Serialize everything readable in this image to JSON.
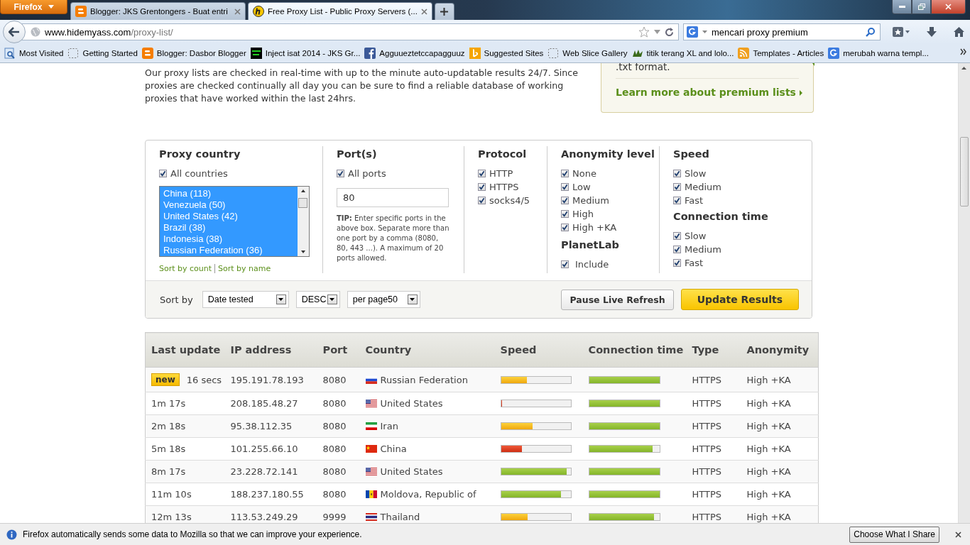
{
  "browser": {
    "menu_button": "Firefox",
    "tabs": [
      {
        "title": "Blogger: JKS Grentongers - Buat entri",
        "selected": false
      },
      {
        "title": "Free Proxy List - Public Proxy Servers (...",
        "selected": true
      }
    ],
    "url": {
      "host": "www.hidemyass.com",
      "path": "/proxy-list/"
    },
    "search": {
      "value": "mencari proxy premium"
    },
    "bookmarks": [
      {
        "label": "Most Visited"
      },
      {
        "label": "Getting Started"
      },
      {
        "label": "Blogger: Dasbor Blogger"
      },
      {
        "label": "Inject isat 2014 - JKS Gr..."
      },
      {
        "label": "Agguueztetccapagguuz"
      },
      {
        "label": "Suggested Sites"
      },
      {
        "label": "Web Slice Gallery"
      },
      {
        "label": "titik terang XL and lolo..."
      },
      {
        "label": "Templates - Articles"
      },
      {
        "label": "merubah warna templ..."
      }
    ]
  },
  "intro": {
    "text": "Our proxy lists are checked in real-time with up to the minute auto-updatable results 24/7. Since proxies are checked continually all day you can be sure to find a reliable database of working proxies that have worked within the last 24hrs."
  },
  "premium_box": {
    "text": ".txt format.",
    "link": "Learn more about premium lists"
  },
  "filters": {
    "country": {
      "title": "Proxy country",
      "all": {
        "label": "All countries",
        "checked": true
      },
      "options": [
        {
          "label": "China (118)",
          "selected": true
        },
        {
          "label": "Venezuela (50)",
          "selected": true
        },
        {
          "label": "United States (42)",
          "selected": true
        },
        {
          "label": "Brazil (38)",
          "selected": true
        },
        {
          "label": "Indonesia (38)",
          "selected": true
        },
        {
          "label": "Russian Federation (36)",
          "selected": true
        }
      ],
      "sort_links": [
        "Sort by count",
        "Sort by name"
      ]
    },
    "ports": {
      "title": "Port(s)",
      "all": {
        "label": "All ports",
        "checked": true
      },
      "value": "80",
      "tip": "**TIP:** Enter specific ports in the above box. Separate more than one port by a comma (8080, 80, 443 ...). A maximum of 20 ports allowed."
    },
    "protocol": {
      "title": "Protocol",
      "options": [
        {
          "label": "HTTP",
          "checked": true
        },
        {
          "label": "HTTPS",
          "checked": true
        },
        {
          "label": "socks4/5",
          "checked": true
        }
      ]
    },
    "anonymity": {
      "title": "Anonymity level",
      "options": [
        {
          "label": "None",
          "checked": true
        },
        {
          "label": "Low",
          "checked": true
        },
        {
          "label": "Medium",
          "checked": true
        },
        {
          "label": "High",
          "checked": true
        },
        {
          "label": "High +KA",
          "checked": true
        }
      ]
    },
    "planetlab": {
      "title": "PlanetLab",
      "options": [
        {
          "label": "Include",
          "checked": true
        }
      ]
    },
    "speed": {
      "title": "Speed",
      "options": [
        {
          "label": "Slow",
          "checked": true
        },
        {
          "label": "Medium",
          "checked": true
        },
        {
          "label": "Fast",
          "checked": true
        }
      ]
    },
    "connection_time": {
      "title": "Connection time",
      "options": [
        {
          "label": "Slow",
          "checked": true
        },
        {
          "label": "Medium",
          "checked": true
        },
        {
          "label": "Fast",
          "checked": true
        }
      ]
    },
    "sort_label": "Sort by",
    "sort_selects": [
      "Date tested",
      "DESC",
      "per page50"
    ],
    "buttons": {
      "pause": "Pause Live Refresh",
      "update": "Update Results"
    }
  },
  "table": {
    "columns": [
      "Last update",
      "IP address",
      "Port",
      "Country",
      "Speed",
      "Connection time",
      "Type",
      "Anonymity"
    ],
    "rows": [
      {
        "badge": "new",
        "last_update": "16 secs",
        "ip": "195.191.78.193",
        "port": "8080",
        "country": "Russian Federation",
        "speed": {
          "level": 0.37
        },
        "connection": {
          "level": 1
        },
        "type": "HTTPS",
        "anonymity": "High +KA"
      },
      {
        "last_update": "1m 17s",
        "ip": "208.185.48.27",
        "port": "8080",
        "country": "United States",
        "speed": {
          "level": 0.02
        },
        "connection": {
          "level": 1
        },
        "type": "HTTPS",
        "anonymity": "High +KA"
      },
      {
        "last_update": "2m 18s",
        "ip": "95.38.112.35",
        "port": "8080",
        "country": "Iran",
        "speed": {
          "level": 0.45
        },
        "connection": {
          "level": 1
        },
        "type": "HTTPS",
        "anonymity": "High +KA"
      },
      {
        "last_update": "5m 18s",
        "ip": "101.255.66.10",
        "port": "8080",
        "country": "China",
        "speed": {
          "level": 0.3
        },
        "connection": {
          "level": 0.9
        },
        "type": "HTTPS",
        "anonymity": "High +KA"
      },
      {
        "last_update": "8m 17s",
        "ip": "23.228.72.141",
        "port": "8080",
        "country": "United States",
        "speed": {
          "level": 0.94
        },
        "connection": {
          "level": 1
        },
        "type": "HTTPS",
        "anonymity": "High +KA"
      },
      {
        "last_update": "11m 10s",
        "ip": "188.237.180.55",
        "port": "8080",
        "country": "Moldova, Republic of",
        "speed": {
          "level": 0.86
        },
        "connection": {
          "level": 1
        },
        "type": "HTTPS",
        "anonymity": "High +KA"
      },
      {
        "last_update": "12m 13s",
        "ip": "113.53.249.29",
        "port": "9999",
        "country": "Thailand",
        "speed": {
          "level": 0.38
        },
        "connection": {
          "level": 0.92
        },
        "type": "HTTPS",
        "anonymity": "High +KA"
      }
    ]
  },
  "notification": {
    "text": "Firefox automatically sends some data to Mozilla so that we can improve your experience.",
    "button": "Choose What I Share"
  }
}
